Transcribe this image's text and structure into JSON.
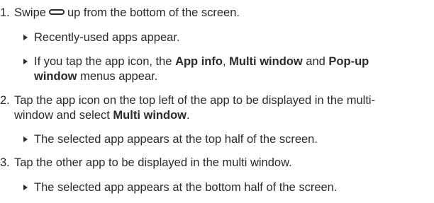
{
  "steps": [
    {
      "number": "1.",
      "text_before_icon": "Swipe",
      "icon": "home-button-icon",
      "text_after_icon": "up from the bottom of the screen.",
      "bullets": [
        {
          "text": "Recently-used apps appear."
        },
        {
          "line1_a": "If you tap the app icon, the ",
          "line1_b1": "App info",
          "line1_c": ", ",
          "line1_b2": "Multi window",
          "line1_d": " and ",
          "line1_b3": "Pop-up",
          "line2_b": "window",
          "line2_c": " menus appear."
        }
      ]
    },
    {
      "number": "2.",
      "line1": "Tap the app icon on the top left of the app to be displayed in the multi-",
      "line2_a": "window and select ",
      "line2_b": "Multi window",
      "line2_c": ".",
      "bullets": [
        {
          "text": "The selected app appears at the top half of the screen."
        }
      ]
    },
    {
      "number": "3.",
      "line1": "Tap the other app to be displayed in the multi window.",
      "bullets": [
        {
          "text": "The selected app appears at the bottom half of the screen."
        }
      ]
    }
  ]
}
